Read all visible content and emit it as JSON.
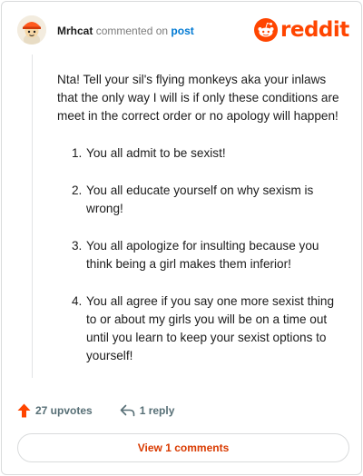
{
  "comment": {
    "username": "Mrhcat",
    "action_text": "commented on",
    "post_link": "post",
    "intro": "Nta! Tell your sil's flying monkeys aka your inlaws that the only way I will is if only these conditions are meet in the correct order or no apology will happen!",
    "items": [
      {
        "num": "1.",
        "text": "You all admit to be sexist!"
      },
      {
        "num": "2.",
        "text": "You all educate yourself on why sexism is wrong!"
      },
      {
        "num": "3.",
        "text": "You all apologize for insulting because you think being a girl makes them inferior!"
      },
      {
        "num": "4.",
        "text": "You all agree if you say one more sexist thing to or about my girls you will be on a time out until you learn to keep your sexist options to yourself!"
      }
    ]
  },
  "brand": {
    "logo_text": "reddit",
    "color": "#ff4500",
    "icon": "reddit-snoo-icon"
  },
  "actions": {
    "upvotes": "27 upvotes",
    "upvote_icon": "upvote-arrow-icon",
    "replies": "1 reply",
    "reply_icon": "reply-icon"
  },
  "view_comments": "View 1 comments"
}
